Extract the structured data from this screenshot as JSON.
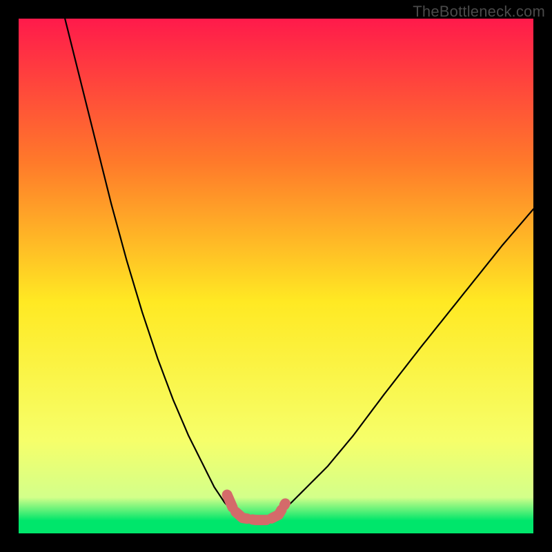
{
  "watermark": "TheBottleneck.com",
  "colors": {
    "gradient_top": "#ff1a4b",
    "gradient_mid_upper": "#ff7a2a",
    "gradient_mid": "#ffe923",
    "gradient_lower": "#f6ff6a",
    "gradient_green": "#00e66b",
    "curve_stroke": "#000000",
    "trough_marker": "#d46a6a",
    "frame": "#000000"
  },
  "chart_data": {
    "type": "line",
    "title": "",
    "xlabel": "",
    "ylabel": "",
    "xlim": [
      0,
      100
    ],
    "ylim": [
      0,
      100
    ],
    "series": [
      {
        "name": "left-curve",
        "x": [
          9,
          12,
          15,
          18,
          21,
          24,
          27,
          30,
          33,
          36,
          38,
          40,
          41.8
        ],
        "y": [
          100,
          88,
          76,
          64,
          53,
          43,
          34,
          26,
          19,
          13,
          9,
          6,
          4
        ]
      },
      {
        "name": "right-curve",
        "x": [
          50.8,
          53,
          56,
          60,
          65,
          71,
          78,
          86,
          94,
          100
        ],
        "y": [
          4,
          6,
          9,
          13,
          19,
          27,
          36,
          46,
          56,
          63
        ]
      }
    ],
    "trough_marker": {
      "points_xy": [
        [
          40.5,
          7.5
        ],
        [
          41.8,
          4.5
        ],
        [
          43.5,
          3.0
        ],
        [
          46.0,
          2.6
        ],
        [
          48.5,
          2.6
        ],
        [
          50.5,
          3.6
        ],
        [
          51.8,
          5.8
        ]
      ],
      "stroke_width_px": 15
    },
    "background_gradient_stops": [
      {
        "offset": 0.0,
        "color": "#ff1a4b"
      },
      {
        "offset": 0.28,
        "color": "#ff7a2a"
      },
      {
        "offset": 0.55,
        "color": "#ffe923"
      },
      {
        "offset": 0.82,
        "color": "#f6ff6a"
      },
      {
        "offset": 0.93,
        "color": "#d3ff8a"
      },
      {
        "offset": 0.975,
        "color": "#00e66b"
      },
      {
        "offset": 1.0,
        "color": "#00e66b"
      }
    ]
  }
}
